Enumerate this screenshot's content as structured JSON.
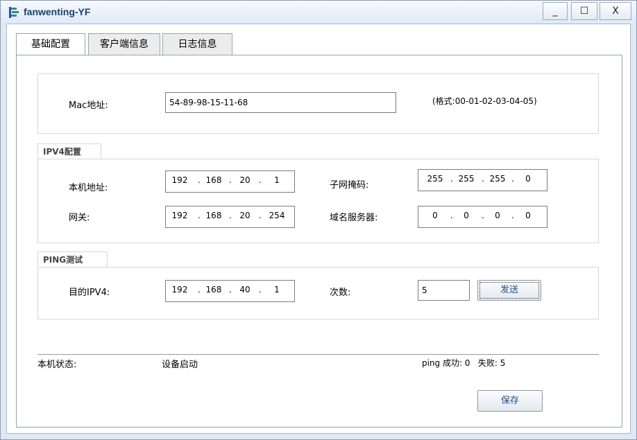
{
  "window": {
    "title": "fanwenting-YF",
    "minimize": "_",
    "maximize": "☐",
    "close": "X"
  },
  "tabs": [
    {
      "label": "基础配置"
    },
    {
      "label": "客户端信息"
    },
    {
      "label": "日志信息"
    }
  ],
  "mac": {
    "label": "Mac地址:",
    "value": "54-89-98-15-11-68",
    "hint": "(格式:00-01-02-03-04-05)"
  },
  "ipv4": {
    "title": "IPV4配置",
    "local_label": "本机地址:",
    "local": [
      "192",
      "168",
      "20",
      "1"
    ],
    "mask_label": "子网掩码:",
    "mask": [
      "255",
      "255",
      "255",
      "0"
    ],
    "gateway_label": "网关:",
    "gateway": [
      "192",
      "168",
      "20",
      "254"
    ],
    "dns_label": "域名服务器:",
    "dns": [
      "0",
      "0",
      "0",
      "0"
    ]
  },
  "ping": {
    "title": "PING测试",
    "target_label": "目的IPV4:",
    "target": [
      "192",
      "168",
      "40",
      "1"
    ],
    "count_label": "次数:",
    "count": "5",
    "send_label": "发送"
  },
  "status": {
    "label": "本机状态:",
    "value": "设备启动",
    "ping_result": "ping 成功: 0   失败: 5"
  },
  "save_label": "保存",
  "colors": {
    "title_text": "#1a3f6e",
    "button_text": "#1b4f8f",
    "frame": "#dfe8f3"
  },
  "icons": {
    "app": "network-app-icon"
  }
}
